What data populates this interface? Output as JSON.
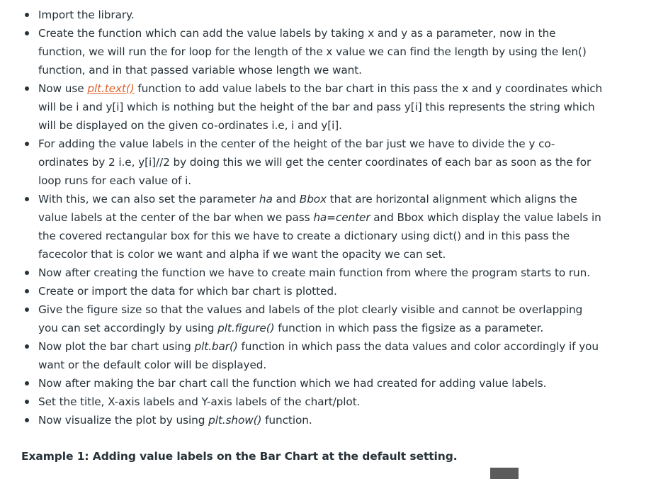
{
  "steps": [
    {
      "text": "Import the library."
    },
    {
      "text": "Create the function which can add the value labels by taking x and y as a parameter, now in the function, we will run the for loop for the length of the x value we can find the length by using the len() function, and in that passed variable whose length we want."
    },
    {
      "pre": "Now use ",
      "link": "plt.text()",
      "post": " function to add value labels to the bar chart in this pass the x and y coordinates which will be i and y[i] which is nothing but the height of the bar and pass y[i] this represents the string which will be displayed on the given co-ordinates i.e, i and y[i]."
    },
    {
      "text": "For adding the value labels in the center of the height of the bar just we have to divide the y co-ordinates by 2 i.e, y[i]//2 by doing this we will get the center coordinates of each bar as soon as the for loop runs for each value of i."
    },
    {
      "p1": "With this, we can also set the parameter ",
      "e1": "ha",
      "p2": " and ",
      "e2": "Bbox",
      "p3": " that are horizontal alignment which aligns the value labels at the center of the bar when we pass ",
      "e3": "ha=center",
      "p4": " and Bbox which display the value labels in the covered rectangular box for this we have to create a dictionary using dict() and in this pass the facecolor that is color we want and alpha if we want the opacity we can set."
    },
    {
      "text": "Now after creating the function we have to create main function from where the program starts to run."
    },
    {
      "text": "Create or import the data for which bar chart is plotted."
    },
    {
      "pre": "Give the figure size so that the values and labels of the plot clearly visible and cannot be overlapping you can set accordingly by using ",
      "code": "plt.figure()",
      "post": " function in which pass the figsize as a parameter."
    },
    {
      "pre": "Now plot the bar chart using ",
      "code": "plt.bar()",
      "post": " function in which pass the data values and color accordingly if you want or the default color will be displayed."
    },
    {
      "text": "Now after making the bar chart call the function which we had created for adding value labels."
    },
    {
      "text": "Set the title, X-axis labels and Y-axis labels of the chart/plot."
    },
    {
      "pre": "Now visualize the plot by using ",
      "code": "plt.show()",
      "post": " function."
    }
  ],
  "example": {
    "heading": "Example 1: Adding value labels on the Bar Chart at the default setting."
  },
  "colors": {
    "text": "#273239",
    "link": "#e15f26",
    "code_block": "#5b5b5b"
  }
}
